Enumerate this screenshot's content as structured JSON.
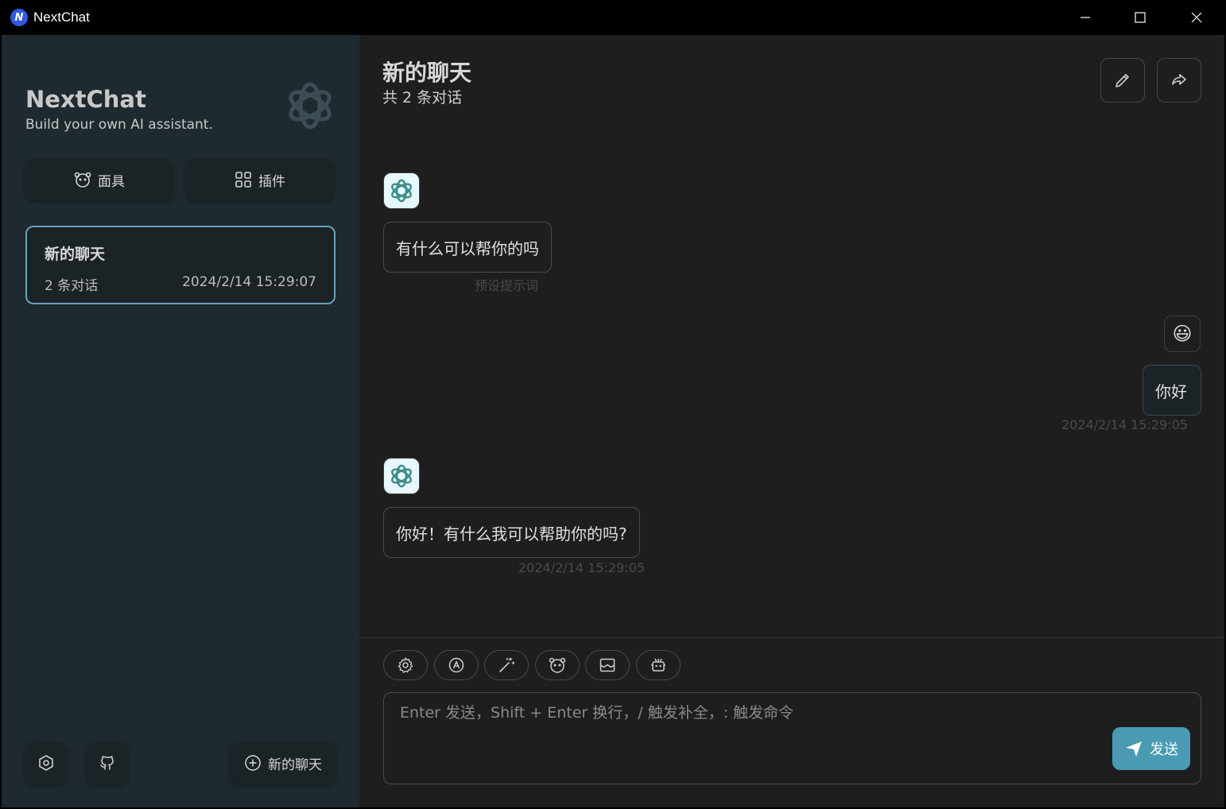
{
  "window": {
    "title": "NextChat",
    "logo_letter": "N"
  },
  "sidebar": {
    "brand_title": "NextChat",
    "brand_subtitle": "Build your own AI assistant.",
    "mask_button": "面具",
    "plugin_button": "插件",
    "sessions": [
      {
        "title": "新的聊天",
        "count": "2 条对话",
        "time": "2024/2/14 15:29:07"
      }
    ],
    "new_chat_button": "新的聊天"
  },
  "chat": {
    "title": "新的聊天",
    "subtitle": "共 2 条对话",
    "messages": [
      {
        "role": "bot",
        "text": "有什么可以帮你的吗",
        "meta": "预设提示词"
      },
      {
        "role": "user",
        "avatar": "😃",
        "text": "你好",
        "meta": "2024/2/14 15:29:05"
      },
      {
        "role": "bot",
        "text": "你好！有什么我可以帮助你的吗?",
        "meta": "2024/2/14 15:29:05"
      }
    ]
  },
  "input": {
    "placeholder": "Enter 发送，Shift + Enter 换行，/ 触发补全，: 触发命令",
    "send_label": "发送"
  },
  "colors": {
    "accent": "#68a1bd",
    "send": "#4a9ab4",
    "sidebar": "#1e2a30",
    "main": "#1e1e1e"
  }
}
